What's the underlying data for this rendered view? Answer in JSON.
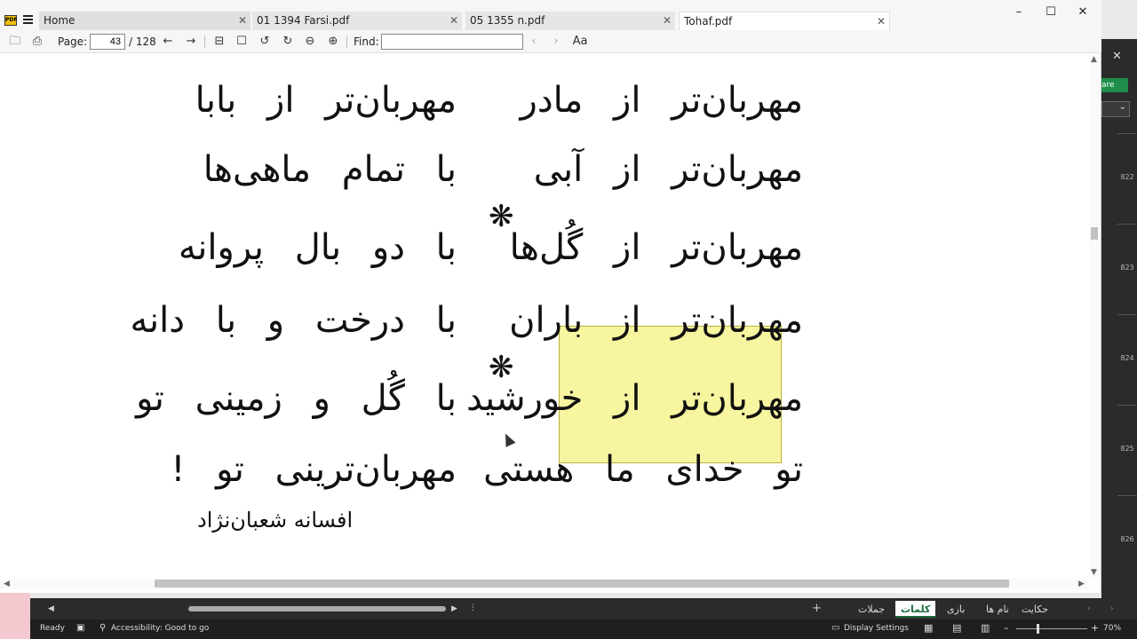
{
  "pdf_viewer": {
    "tabs": [
      {
        "label": "Home"
      },
      {
        "label": "01 1394 Farsi.pdf"
      },
      {
        "label": "05 1355 n.pdf"
      },
      {
        "label": "Tohaf.pdf"
      }
    ],
    "app_logo_text": "PDF",
    "window_controls": {
      "minimize": "–",
      "maximize": "☐",
      "close": "✕"
    },
    "toolbar": {
      "page_label": "Page:",
      "page_value": "43",
      "page_total": "/ 128",
      "find_label": "Find:",
      "find_value": ""
    },
    "document": {
      "left_column": [
        "مهربان‌تر از بابا",
        "با تمام ماهی‌ها",
        "با دو بال پروانه",
        "با درخت و با دانه",
        "با گُل و زمینی تو",
        "مهربان‌ترینی تو !"
      ],
      "right_column": [
        "مهربان‌تر از مادر",
        "مهربان‌تر از آبی",
        "مهربان‌تر از گُل‌ها",
        "مهربان‌تر از باران",
        "مهربان‌تر از خورشید",
        "تو خدای ما هستی"
      ],
      "separator_glyph": "❋",
      "author": "افسانه شعبان‌نژاد"
    }
  },
  "excel_background": {
    "share_button": "are",
    "row_numbers": [
      "822",
      "823",
      "824",
      "825",
      "826"
    ],
    "sheet_tabs": [
      "کلمات",
      "جملات",
      "بازی",
      "نام ها",
      "حکایت"
    ],
    "active_sheet": "کلمات",
    "status": {
      "ready": "Ready",
      "accessibility": "Accessibility: Good to go",
      "display_settings": "Display Settings",
      "zoom": "70%"
    }
  }
}
